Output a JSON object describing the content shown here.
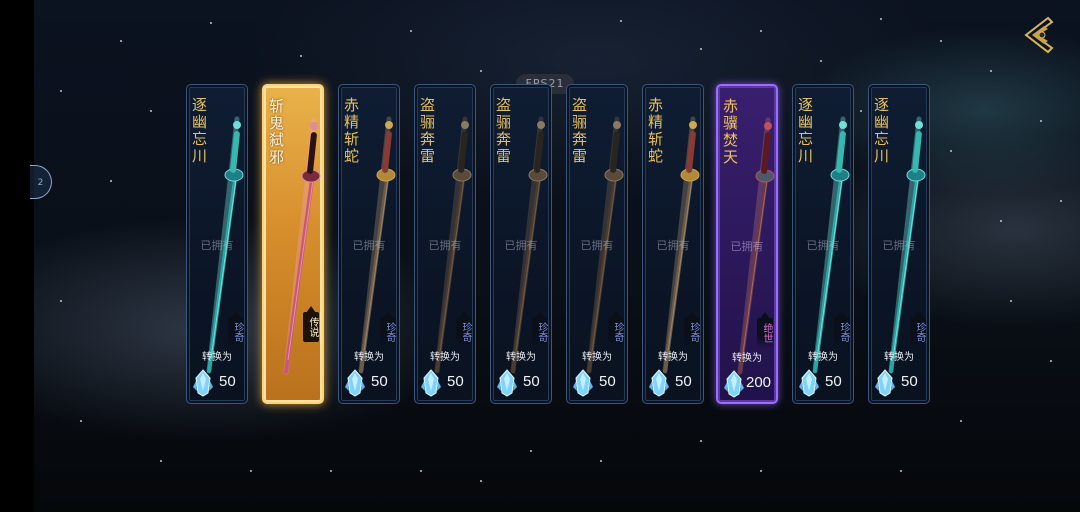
{
  "top_badge": "FPS21",
  "side_handle": "2",
  "cards": [
    {
      "name": "逐幽忘川",
      "owned": "已拥有",
      "rarity": "珍奇",
      "convert": "转换为",
      "cost": "50",
      "style": "blue",
      "sword": "teal"
    },
    {
      "name": "斩鬼弑邪",
      "owned": "",
      "rarity": "传说",
      "convert": "",
      "cost": "",
      "style": "gold",
      "sword": "rose"
    },
    {
      "name": "赤精斩蛇",
      "owned": "已拥有",
      "rarity": "珍奇",
      "convert": "转换为",
      "cost": "50",
      "style": "blue",
      "sword": "bronze"
    },
    {
      "name": "盗骊奔雷",
      "owned": "已拥有",
      "rarity": "珍奇",
      "convert": "转换为",
      "cost": "50",
      "style": "blue",
      "sword": "dark"
    },
    {
      "name": "盗骊奔雷",
      "owned": "已拥有",
      "rarity": "珍奇",
      "convert": "转换为",
      "cost": "50",
      "style": "blue",
      "sword": "dark"
    },
    {
      "name": "盗骊奔雷",
      "owned": "已拥有",
      "rarity": "珍奇",
      "convert": "转换为",
      "cost": "50",
      "style": "blue",
      "sword": "dark"
    },
    {
      "name": "赤精斩蛇",
      "owned": "已拥有",
      "rarity": "珍奇",
      "convert": "转换为",
      "cost": "50",
      "style": "blue",
      "sword": "bronze"
    },
    {
      "name": "赤骥焚天",
      "owned": "已拥有",
      "rarity": "绝世",
      "convert": "转换为",
      "cost": "200",
      "style": "purple",
      "sword": "ember"
    },
    {
      "name": "逐幽忘川",
      "owned": "已拥有",
      "rarity": "珍奇",
      "convert": "转换为",
      "cost": "50",
      "style": "blue",
      "sword": "teal"
    },
    {
      "name": "逐幽忘川",
      "owned": "已拥有",
      "rarity": "珍奇",
      "convert": "转换为",
      "cost": "50",
      "style": "blue",
      "sword": "teal"
    }
  ],
  "colors": {
    "accent_gold": "#e8c05a",
    "legendary_frame": "#ffd27a",
    "epic_frame": "#9b6cff",
    "rare_frame": "#3a567f"
  }
}
